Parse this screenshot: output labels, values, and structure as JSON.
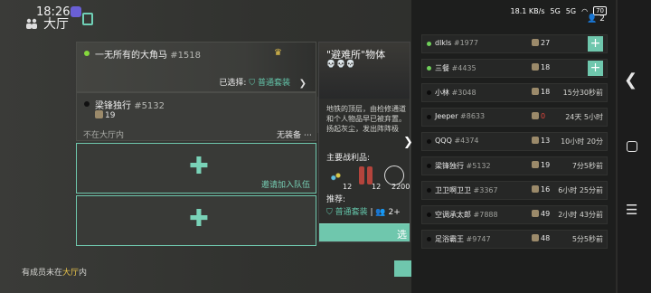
{
  "status": {
    "time": "18:26",
    "net": "18.1\nKB/s",
    "signal1": "5G",
    "signal2": "5G",
    "battery": "70"
  },
  "lobby": {
    "title": "大厅"
  },
  "players": [
    {
      "name": "一无所有的大角马",
      "id": "#1518",
      "online": true,
      "selected_label": "已选择:",
      "selected_value": "普通套装"
    },
    {
      "name": "梁锋独行",
      "id": "#5132",
      "online": false,
      "coins": "19",
      "status": "不在大厅内",
      "equipment": "无装备"
    }
  ],
  "slots": {
    "invite_label": "邀请加入队伍"
  },
  "shelter": {
    "title": "\"避难所\"物体",
    "skulls": "💀💀💀",
    "description": "地铁的顶层，由检修通道和个人物品早已被弃置。扬起灰尘，发出阵阵极",
    "loot_label": "主要战利品:",
    "loot_counts": [
      "12",
      "12",
      "2200"
    ],
    "recommend_label": "推荐:",
    "recommend_value": "普通套装",
    "recommend_extra": "2+",
    "select_button": "选"
  },
  "footer": {
    "message_prefix": "有成员未在",
    "message_highlight": "大厅",
    "message_suffix": "内"
  },
  "friends": {
    "count": "2",
    "items": [
      {
        "name": "dlkls",
        "id": "#1977",
        "online": true,
        "coins": "27",
        "time": "",
        "add": true,
        "red": false
      },
      {
        "name": "三餐",
        "id": "#4435",
        "online": true,
        "coins": "18",
        "time": "",
        "add": true,
        "red": false
      },
      {
        "name": "小林",
        "id": "#3048",
        "online": false,
        "coins": "18",
        "time": "15分30秒前",
        "add": false,
        "red": false
      },
      {
        "name": "Jeeper",
        "id": "#8633",
        "online": false,
        "coins": "0",
        "time": "24天 5小时",
        "add": false,
        "red": true
      },
      {
        "name": "QQQ",
        "id": "#4374",
        "online": false,
        "coins": "13",
        "time": "10小时 20分",
        "add": false,
        "red": false
      },
      {
        "name": "梁锋独行",
        "id": "#5132",
        "online": false,
        "coins": "19",
        "time": "7分5秒前",
        "add": false,
        "red": false
      },
      {
        "name": "卫卫啊卫卫",
        "id": "#3367",
        "online": false,
        "coins": "16",
        "time": "6小时 25分前",
        "add": false,
        "red": false
      },
      {
        "name": "空调承太郎",
        "id": "#7888",
        "online": false,
        "coins": "49",
        "time": "2小时 43分前",
        "add": false,
        "red": false
      },
      {
        "name": "足浴霸王",
        "id": "#9747",
        "online": false,
        "coins": "48",
        "time": "5分5秒前",
        "add": false,
        "red": false
      }
    ]
  },
  "colors": {
    "accent": "#6fc7ad",
    "online": "#6fd05a",
    "crown": "#e8c64d",
    "warning": "#e0463c"
  }
}
